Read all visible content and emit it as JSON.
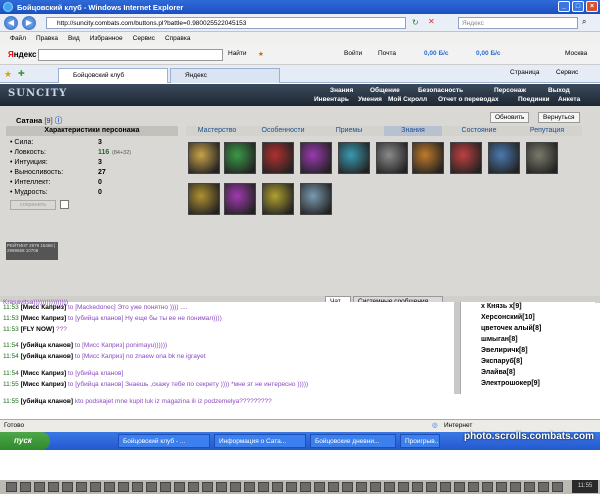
{
  "window": {
    "title": "Бойцовский клуб - Windows Internet Explorer"
  },
  "address": {
    "url": "http://suncity.combats.com/buttons.pl?battle=0.980025522045153",
    "search_placeholder": "Яндекс"
  },
  "menu": [
    "Файл",
    "Правка",
    "Вид",
    "Избранное",
    "Сервис",
    "Справка"
  ],
  "yandex": {
    "logo_y": "Я",
    "logo_rest": "ндекс",
    "find": "Найти",
    "login": "Войти",
    "mail": "Почта",
    "speed1": "0,00 Б/с",
    "speed2": "0,00 Б/с",
    "city": "Москва"
  },
  "tabs": [
    {
      "label": "Бойцовский клуб"
    },
    {
      "label": "Яндекс"
    }
  ],
  "toolbar": {
    "page": "Страница",
    "service": "Сервис"
  },
  "game": {
    "logo": "SUNCITY",
    "nav_top": [
      "Знания",
      "Общение",
      "Безопасность",
      "Персонаж",
      "Выход"
    ],
    "nav_sub": [
      "Инвентарь",
      "Умения",
      "Мой Скролл",
      "Отчет о переводах",
      "Поединки",
      "Анкета"
    ],
    "char_name": "Сатана",
    "char_level": "[9]",
    "refresh": "Обновить",
    "back": "Вернуться",
    "stats_title": "Характеристики персонажа",
    "stats": [
      {
        "label": "Сила:",
        "value": "3",
        "bonus": ""
      },
      {
        "label": "Ловкость:",
        "value": "116",
        "bonus": "(84+32)"
      },
      {
        "label": "Интуиция:",
        "value": "3",
        "bonus": ""
      },
      {
        "label": "Выносливость:",
        "value": "27",
        "bonus": ""
      },
      {
        "label": "Интеллект:",
        "value": "0",
        "bonus": ""
      },
      {
        "label": "Мудрость:",
        "value": "0",
        "bonus": ""
      }
    ],
    "save": "сохранить",
    "skill_tabs": [
      "Мастерство",
      "Особенности",
      "Приемы",
      "Знания",
      "Состояние",
      "Репутация"
    ],
    "banner": "РЕЙТИНГ 2979 15466 | 2999658 10708",
    "slot_colors": [
      "#c9a24a",
      "#3a9a48",
      "#b03030",
      "#9a3ab0",
      "#3a9ab0",
      "#8a8a8a",
      "#c07a2a",
      "#c04040",
      "#4a7ab0",
      "#7a7a6a",
      "#b09030",
      "#a03ab0",
      "#b0a030",
      "#7a9ab0"
    ]
  },
  "chat": {
    "tab_chat": "Чат",
    "tab_sys": "Системные сообщения",
    "partial_top": "Krasavitsa))))))))))))))))",
    "lines": [
      {
        "time": "11:53",
        "name": "[Мисс Каприз]",
        "to": "to [Mackedonec]",
        "msg": "Это уже понятно )))) ...."
      },
      {
        "time": "11:53",
        "name": "[Мисс Каприз]",
        "to": "to [убийца кланов]",
        "msg": "Ну еще бы ты ее не понимал))))"
      },
      {
        "time": "11:53",
        "name": "[FLY NOW]",
        "to": "",
        "msg": "???"
      },
      {
        "time": "11:54",
        "name": "[убийца кланов]",
        "to": "to [Мисс Каприз]",
        "msg": "ponimayu))))))"
      },
      {
        "time": "11:54",
        "name": "[убийца кланов]",
        "to": "to [Мисс Каприз]",
        "msg": "no znaew ona bk ne igrayet"
      },
      {
        "time": "11:54",
        "name": "[Мисс Каприз]",
        "to": "to [убийца кланов]",
        "msg": ""
      },
      {
        "time": "11:55",
        "name": "[Мисс Каприз]",
        "to": "to [убийца кланов]",
        "msg": "Знаешь ,скажу тебе по секрету )))) *мне эт не интересно )))))"
      },
      {
        "time": "11:55",
        "name": "[убийца кланов]",
        "to": "",
        "msg": "kto podskajet mne kupit luk iz magazina ili iz podzemelya?????????"
      }
    ],
    "users": [
      "х Князь х[9]",
      "Херсонский[10]",
      "цветочек алый[8]",
      "шмыган[8]",
      "Эвелиричк[8]",
      "Экспаруб[8]",
      "Элайва[8]",
      "Электрошокер[9]"
    ],
    "clock": "11:55"
  },
  "status": {
    "left": "Готово",
    "zone": "Интернет"
  },
  "taskbar": {
    "start": "пуск",
    "items": [
      "Бойцовский клуб - ...",
      "Информация о Сата...",
      "Бойцовские дневни...",
      "Проигрыв..."
    ],
    "watermark": "photo.scrolls.combats.com"
  }
}
